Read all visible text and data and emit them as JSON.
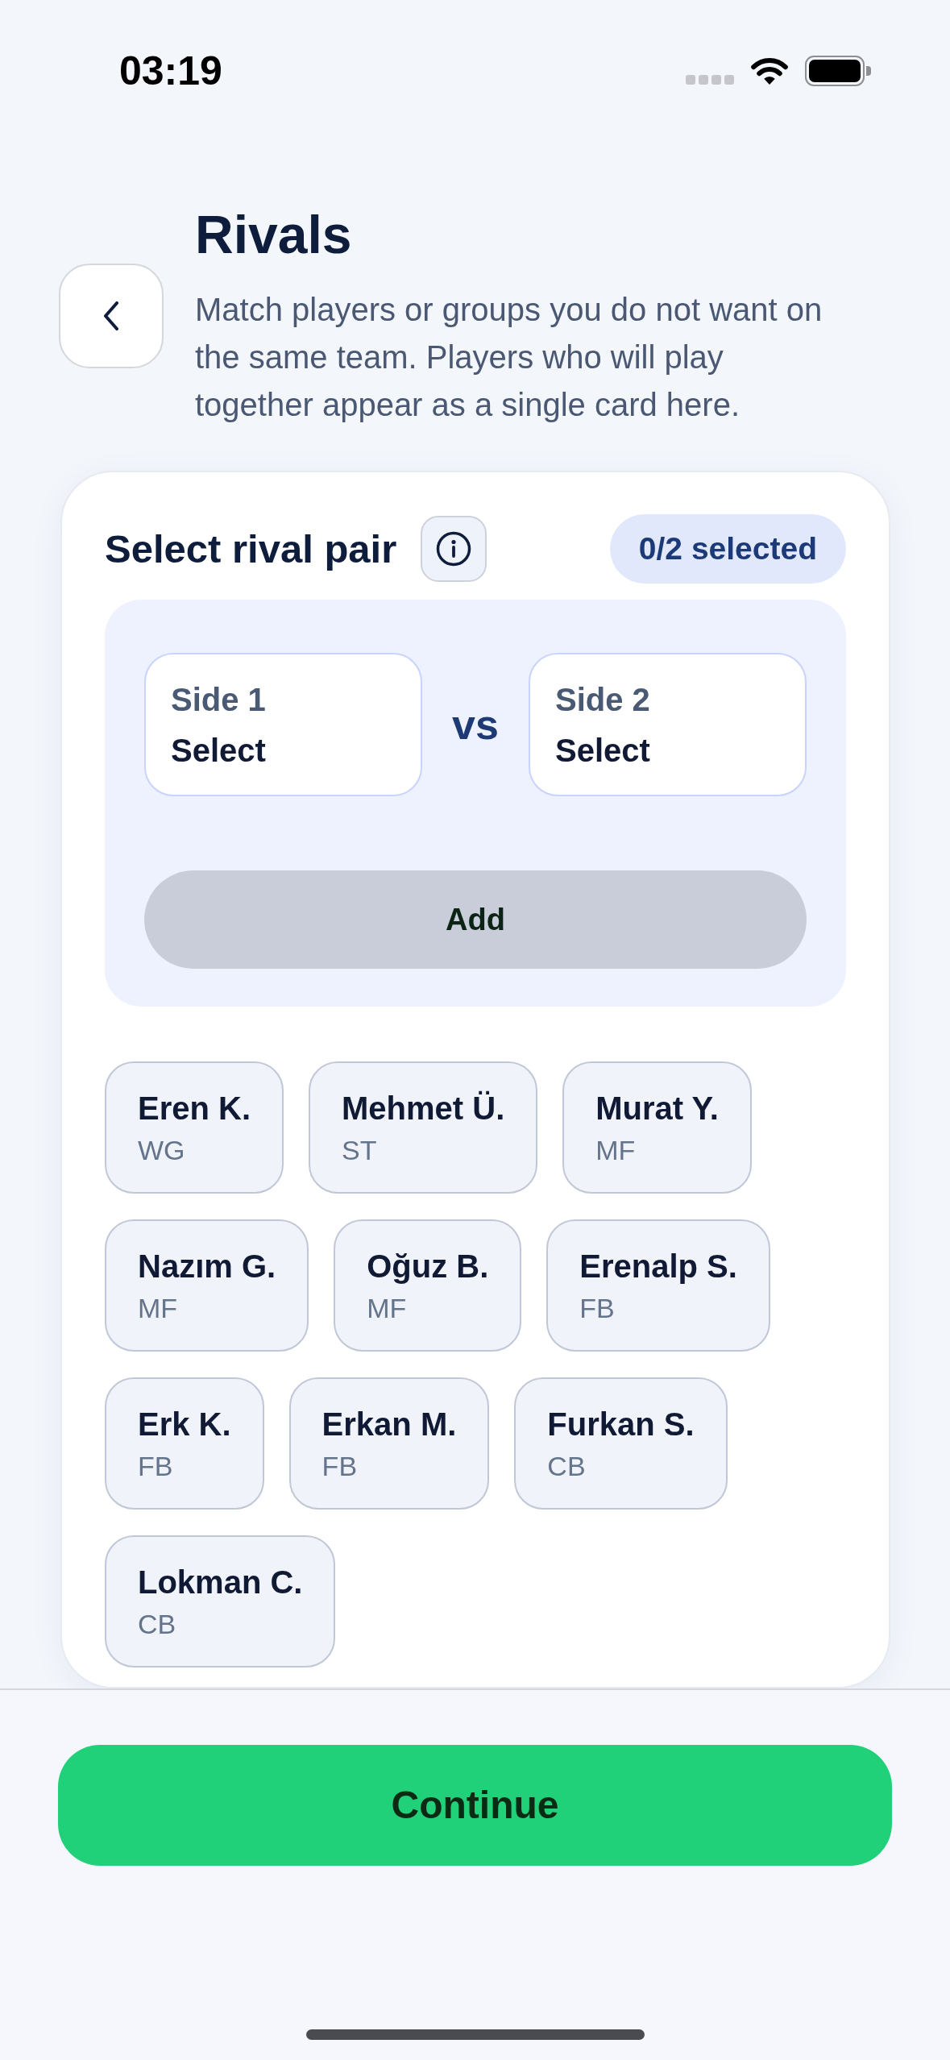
{
  "status_bar": {
    "time": "03:19"
  },
  "header": {
    "title": "Rivals",
    "description": "Match players or groups you do not want on the same team. Players who will play together appear as a single card here."
  },
  "rival_pair": {
    "title": "Select rival pair",
    "selection_count": "0/2 selected",
    "sides": [
      {
        "label": "Side 1",
        "value": "Select"
      },
      {
        "label": "Side 2",
        "value": "Select"
      }
    ],
    "separator": "vs",
    "add_button": {
      "label": "Add",
      "disabled": true
    }
  },
  "players": [
    {
      "name": "Eren K.",
      "position": "WG",
      "selected": false
    },
    {
      "name": "Mehmet Ü.",
      "position": "ST",
      "selected": false
    },
    {
      "name": "Murat Y.",
      "position": "MF",
      "selected": false
    },
    {
      "name": "Nazım G.",
      "position": "MF",
      "selected": false
    },
    {
      "name": "Oğuz B.",
      "position": "MF",
      "selected": false
    },
    {
      "name": "Erenalp S.",
      "position": "FB",
      "selected": false
    },
    {
      "name": "Erk K.",
      "position": "FB",
      "selected": false
    },
    {
      "name": "Erkan M.",
      "position": "FB",
      "selected": false
    },
    {
      "name": "Furkan S.",
      "position": "CB",
      "selected": false
    },
    {
      "name": "Lokman C.",
      "position": "CB",
      "selected": false
    }
  ],
  "continue_button": {
    "label": "Continue"
  }
}
